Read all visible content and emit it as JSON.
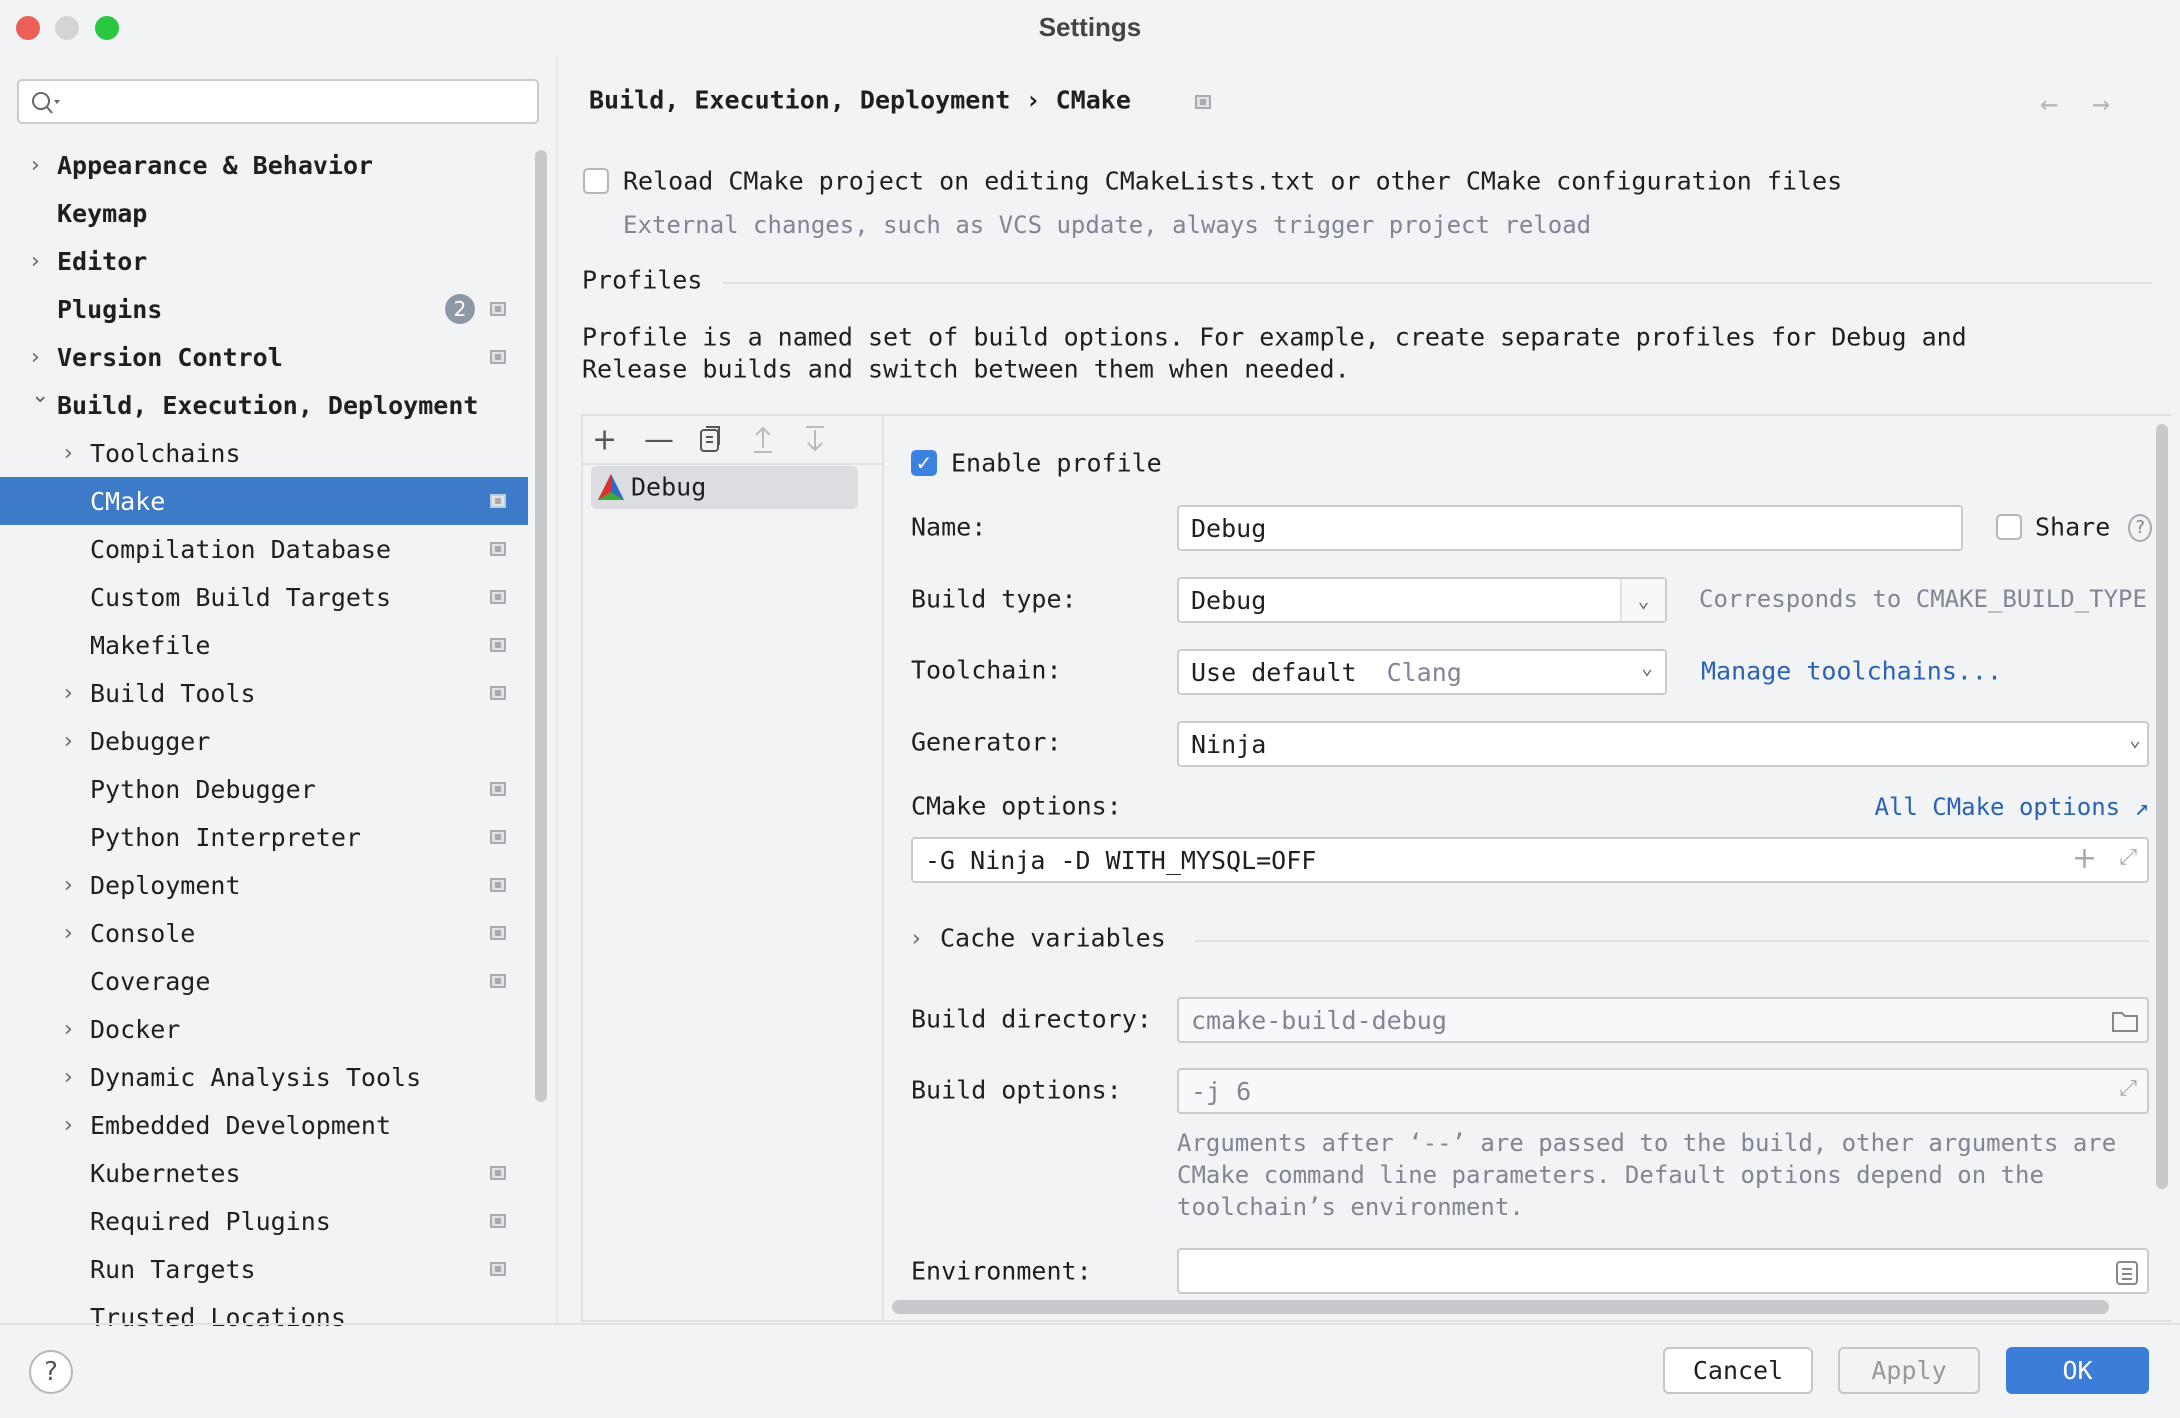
{
  "window": {
    "title": "Settings",
    "controls": {
      "close": "#ec5f57",
      "minimize": "#d4d4d6",
      "maximize": "#29c840"
    }
  },
  "search": {
    "placeholder": "",
    "icon": "search-icon"
  },
  "sidebar": {
    "items": [
      {
        "label": "Appearance & Behavior",
        "level": 0,
        "chevron": "right"
      },
      {
        "label": "Keymap",
        "level": 0
      },
      {
        "label": "Editor",
        "level": 0,
        "chevron": "right"
      },
      {
        "label": "Plugins",
        "level": 0,
        "badge": "2",
        "square": true
      },
      {
        "label": "Version Control",
        "level": 0,
        "chevron": "right",
        "square": true
      },
      {
        "label": "Build, Execution, Deployment",
        "level": 0,
        "chevron": "down"
      },
      {
        "label": "Toolchains",
        "level": 1,
        "chevron": "right"
      },
      {
        "label": "CMake",
        "level": 1,
        "square": true,
        "selected": true
      },
      {
        "label": "Compilation Database",
        "level": 1,
        "square": true
      },
      {
        "label": "Custom Build Targets",
        "level": 1,
        "square": true
      },
      {
        "label": "Makefile",
        "level": 1,
        "square": true
      },
      {
        "label": "Build Tools",
        "level": 1,
        "chevron": "right",
        "square": true
      },
      {
        "label": "Debugger",
        "level": 1,
        "chevron": "right"
      },
      {
        "label": "Python Debugger",
        "level": 1,
        "square": true
      },
      {
        "label": "Python Interpreter",
        "level": 1,
        "square": true
      },
      {
        "label": "Deployment",
        "level": 1,
        "chevron": "right",
        "square": true
      },
      {
        "label": "Console",
        "level": 1,
        "chevron": "right",
        "square": true
      },
      {
        "label": "Coverage",
        "level": 1,
        "square": true
      },
      {
        "label": "Docker",
        "level": 1,
        "chevron": "right"
      },
      {
        "label": "Dynamic Analysis Tools",
        "level": 1,
        "chevron": "right"
      },
      {
        "label": "Embedded Development",
        "level": 1,
        "chevron": "right"
      },
      {
        "label": "Kubernetes",
        "level": 1,
        "square": true
      },
      {
        "label": "Required Plugins",
        "level": 1,
        "square": true
      },
      {
        "label": "Run Targets",
        "level": 1,
        "square": true
      },
      {
        "label": "Trusted Locations",
        "level": 1
      }
    ]
  },
  "breadcrumb": {
    "parent": "Build, Execution, Deployment",
    "separator": "›",
    "current": "CMake"
  },
  "reload": {
    "label": "Reload CMake project on editing CMakeLists.txt or other CMake configuration files",
    "checked": false,
    "hint": "External changes, such as VCS update, always trigger project reload"
  },
  "profiles": {
    "heading": "Profiles",
    "description1": "Profile is a named set of build options. For example, create separate profiles for Debug and",
    "description2": "Release builds and switch between them when needed.",
    "list": [
      "Debug"
    ]
  },
  "form": {
    "enable_label": "Enable profile",
    "enable_checked": true,
    "name_label": "Name:",
    "name_value": "Debug",
    "share_label": "Share",
    "share_checked": false,
    "share_help": "?",
    "build_type_label": "Build type:",
    "build_type_value": "Debug",
    "build_type_hint": "Corresponds to CMAKE_BUILD_TYPE",
    "toolchain_label": "Toolchain:",
    "toolchain_value": "Use default",
    "toolchain_detail": "Clang",
    "manage_link": "Manage toolchains...",
    "generator_label": "Generator:",
    "generator_value": "Ninja",
    "cmake_options_label": "CMake options:",
    "all_options_link": "All CMake options ↗",
    "cmake_options_value": "-G Ninja -D WITH_MYSQL=OFF",
    "cache_label": "Cache variables",
    "build_dir_label": "Build directory:",
    "build_dir_placeholder": "cmake-build-debug",
    "build_options_label": "Build options:",
    "build_options_placeholder": "-j 6",
    "build_options_help1": "Arguments after ‘--’ are passed to the build, other arguments are",
    "build_options_help2": "CMake command line parameters. Default options depend on the",
    "build_options_help3": "toolchain’s environment.",
    "environment_label": "Environment:",
    "environment_value": ""
  },
  "footer": {
    "help": "?",
    "cancel": "Cancel",
    "apply": "Apply",
    "ok": "OK"
  },
  "colors": {
    "selection": "#3d7bc9",
    "link": "#2a62b5",
    "primary": "#3b7dd8"
  }
}
